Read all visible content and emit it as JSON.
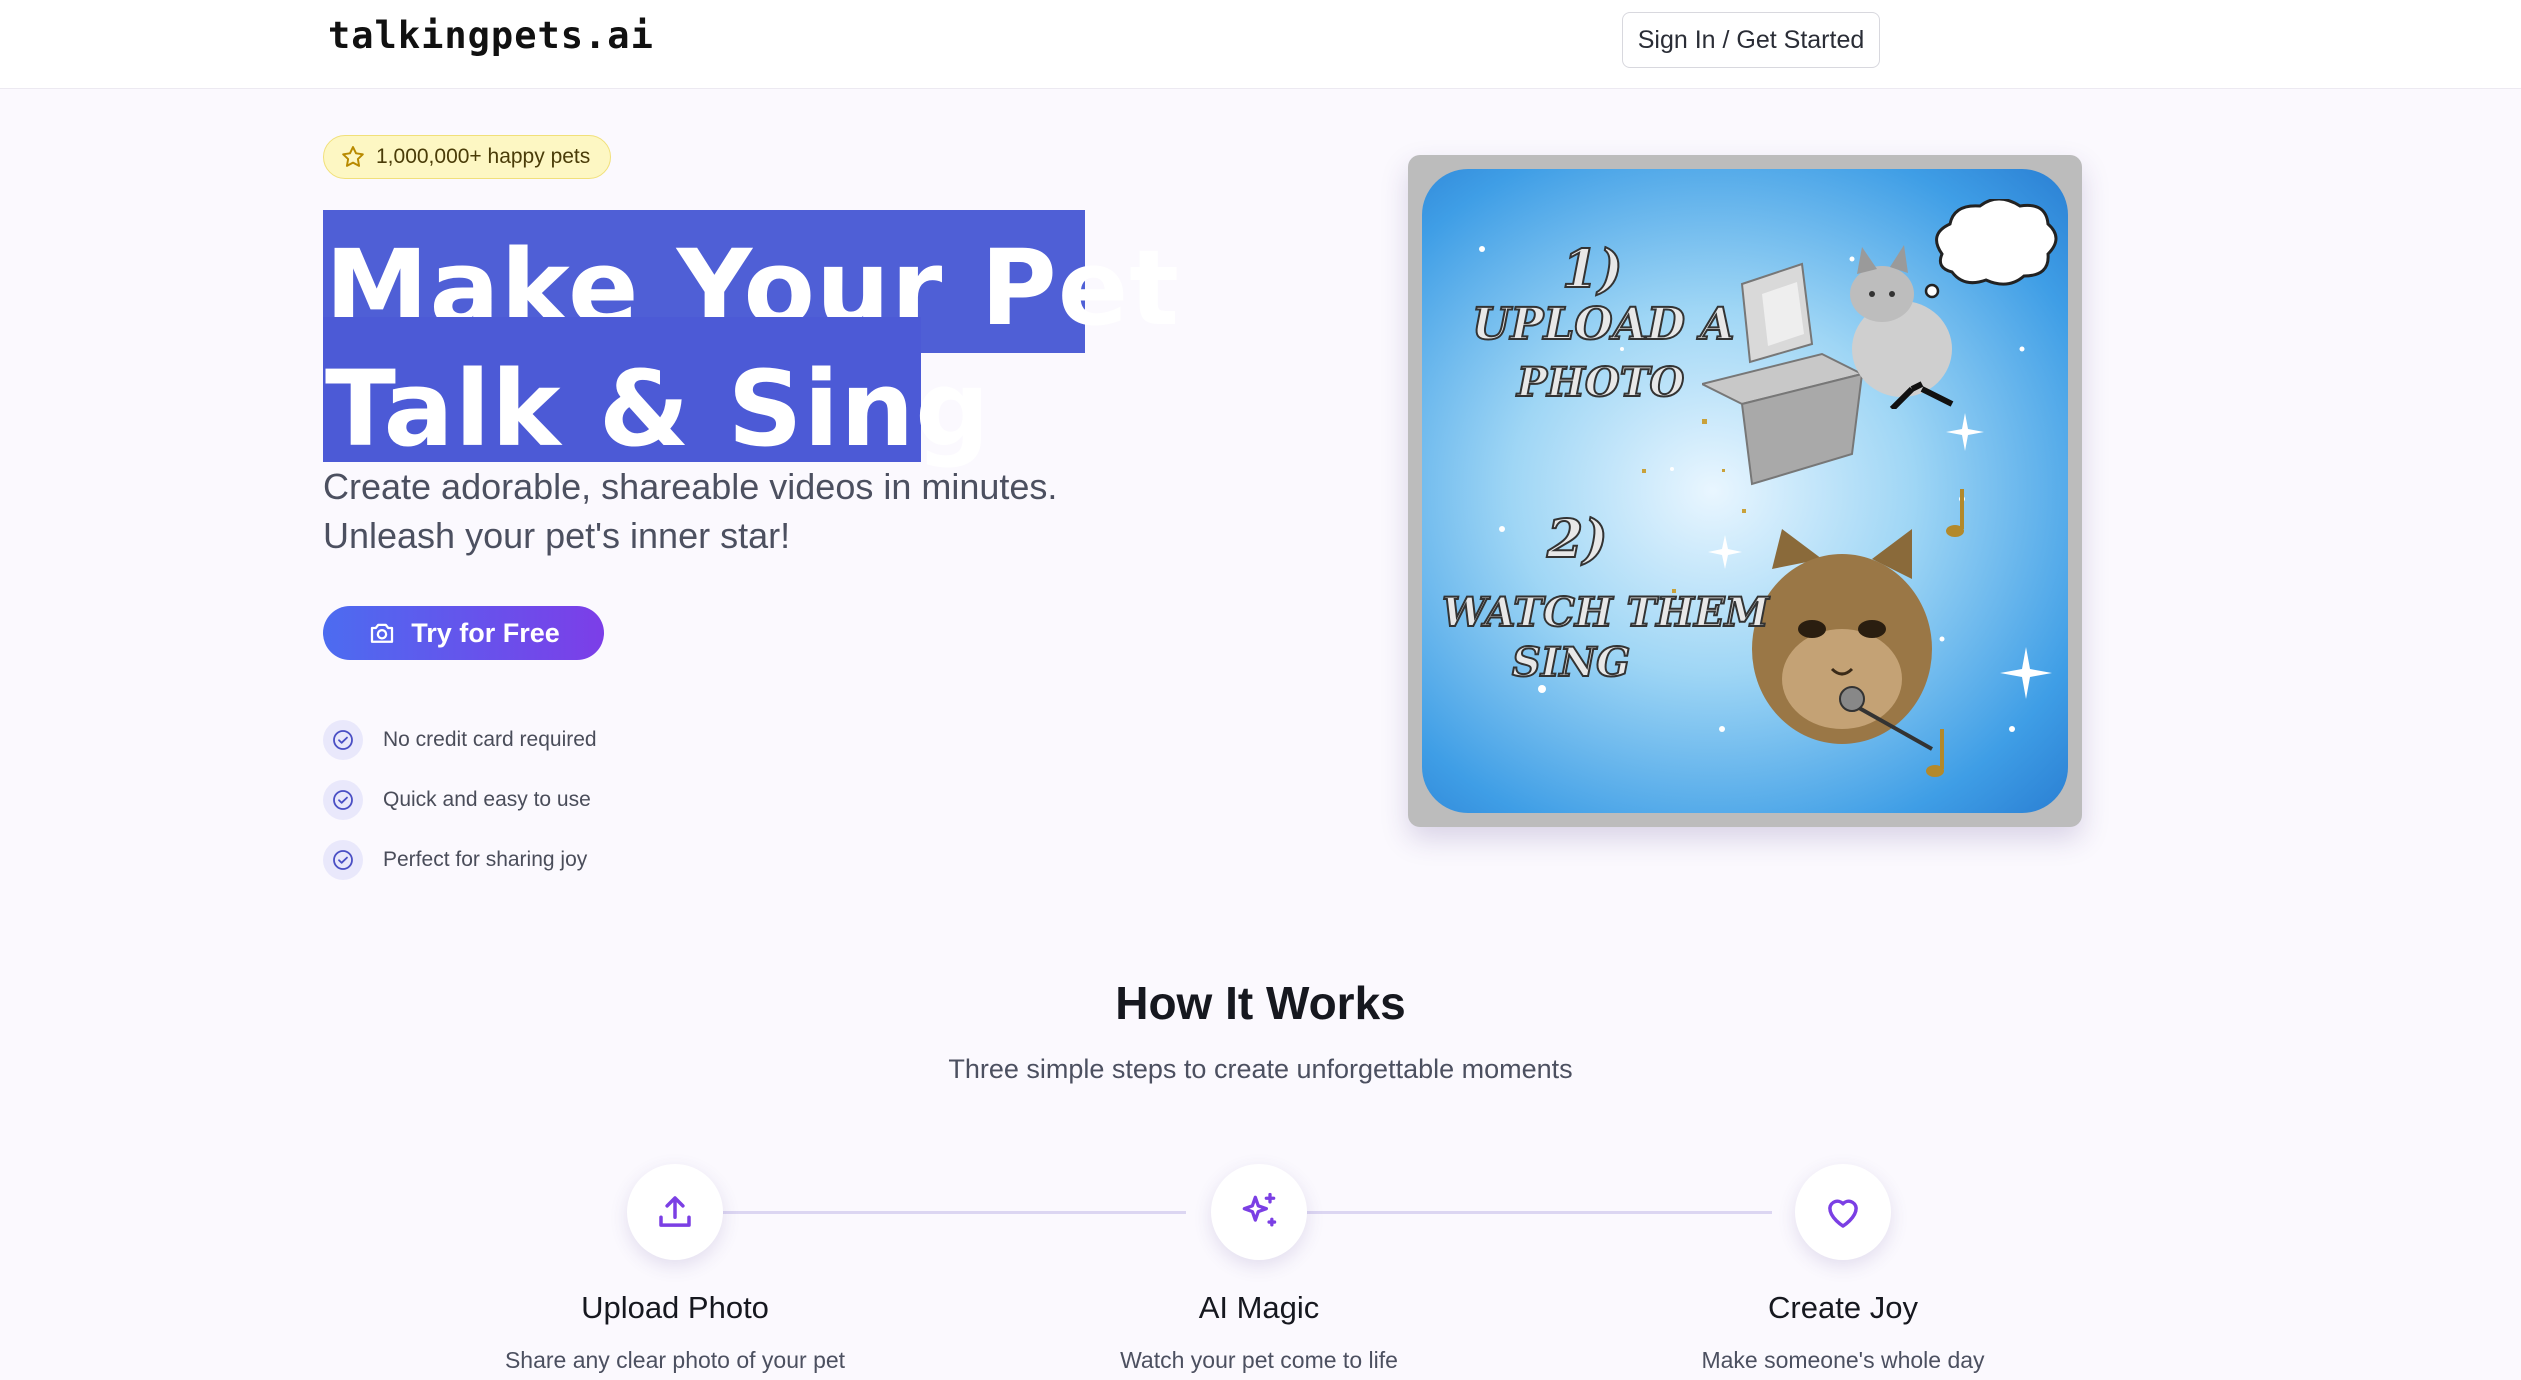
{
  "header": {
    "logo": "talkingpets.ai",
    "signin_label": "Sign In / Get Started"
  },
  "hero": {
    "badge": "1,000,000+ happy pets",
    "headline_line1": "Make Your Pet",
    "headline_line2": "Talk & Sing",
    "subtitle_line1": "Create adorable, shareable videos in minutes.",
    "subtitle_line2": "Unleash your pet's inner star!",
    "cta_label": "Try for Free",
    "checks": [
      "No credit card required",
      "Quick and easy to use",
      "Perfect for sharing joy"
    ]
  },
  "hero_image": {
    "step1_num": "1)",
    "step1_line1": "UPLOAD A",
    "step1_line2": "PHOTO",
    "step2_num": "2)",
    "step2_line1": "WATCH THEM",
    "step2_line2": "SING"
  },
  "how_it_works": {
    "title": "How It Works",
    "subtitle": "Three simple steps to create unforgettable moments",
    "steps": [
      {
        "title": "Upload Photo",
        "desc": "Share any clear photo of your pet",
        "icon": "upload-icon"
      },
      {
        "title": "AI Magic",
        "desc": "Watch your pet come to life",
        "icon": "sparkles-icon"
      },
      {
        "title": "Create Joy",
        "desc": "Make someone's whole day",
        "icon": "heart-icon"
      }
    ]
  },
  "colors": {
    "accent": "#4f5fd6",
    "cta_start": "#4c6cf0",
    "cta_end": "#7c3ee8",
    "icon_purple": "#7b3fe4"
  }
}
